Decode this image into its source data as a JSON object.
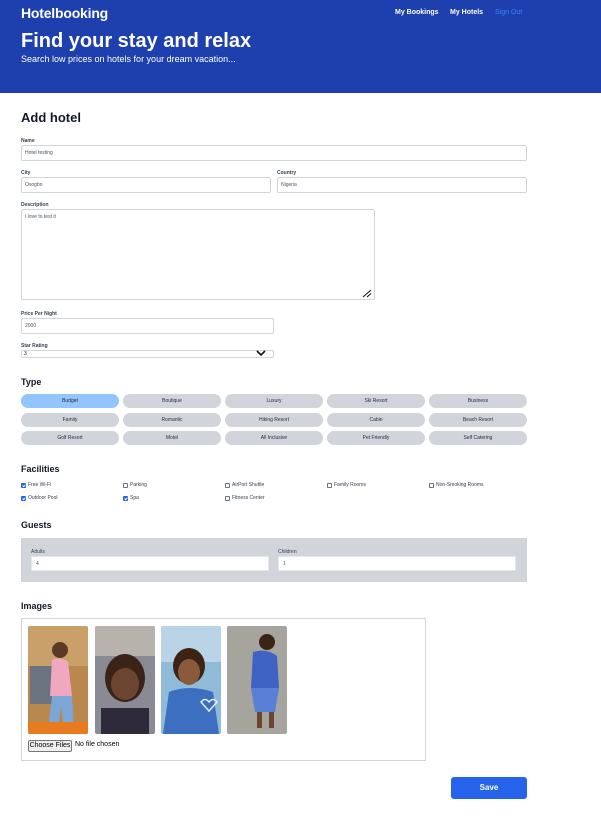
{
  "header": {
    "logo": "Hotelbooking",
    "nav": [
      "My Bookings",
      "My Hotels",
      "Sign Out"
    ],
    "hero_title": "Find your stay and relax",
    "hero_subtitle": "Search low prices on hotels for your dream vacation..."
  },
  "form": {
    "title": "Add hotel",
    "name_label": "Name",
    "name_value": "Hotel testing",
    "city_label": "City",
    "city_value": "Osogbo",
    "country_label": "Country",
    "country_value": "Nigeria",
    "description_label": "Description",
    "description_value": "I love to test it",
    "price_label": "Price Per Night",
    "price_value": "2000",
    "star_label": "Star Rating",
    "star_value": "3"
  },
  "type": {
    "title": "Type",
    "options": [
      "Budget",
      "Boutique",
      "Luxury",
      "Ski Resort",
      "Business",
      "Family",
      "Romantic",
      "Hiking Resort",
      "Cabin",
      "Beach Resort",
      "Golf Resort",
      "Motel",
      "All Inclusive",
      "Pet Friendly",
      "Self Catering"
    ],
    "selected": "Budget"
  },
  "facilities": {
    "title": "Facilities",
    "items": [
      {
        "label": "Free Wi-Fi",
        "checked": true
      },
      {
        "label": "Parking",
        "checked": false
      },
      {
        "label": "AirPort Shuttle",
        "checked": false
      },
      {
        "label": "Family Rooms",
        "checked": false
      },
      {
        "label": "Non-Smoking Rooms",
        "checked": false
      },
      {
        "label": "Outdoor Pool",
        "checked": true
      },
      {
        "label": "Spa",
        "checked": true
      },
      {
        "label": "Fitness Center",
        "checked": false
      }
    ]
  },
  "guests": {
    "title": "Guests",
    "adults_label": "Adults",
    "adults_value": "4",
    "children_label": "Children",
    "children_value": "1"
  },
  "images": {
    "title": "Images",
    "thumbnails": [
      "photo-1",
      "photo-2",
      "photo-3",
      "photo-4"
    ],
    "choose_files_label": "Choose Files",
    "no_file_text": "No file chosen"
  },
  "save_label": "Save",
  "colors": {
    "header_bg": "#1e40af",
    "accent": "#2563eb",
    "chip": "#d1d5db",
    "chip_active": "#93c5fd"
  }
}
